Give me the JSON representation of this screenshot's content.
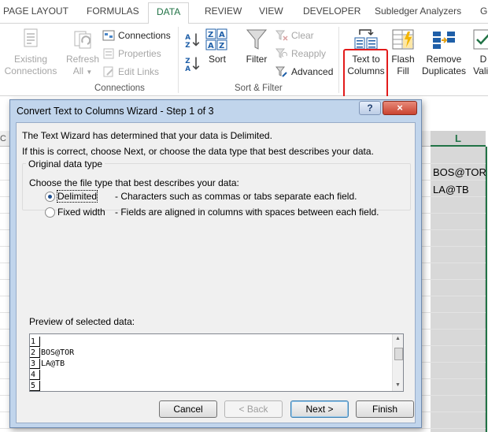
{
  "tabs": [
    {
      "label": "PAGE LAYOUT",
      "active": false
    },
    {
      "label": "FORMULAS",
      "active": false
    },
    {
      "label": "DATA",
      "active": true
    },
    {
      "label": "REVIEW",
      "active": false
    },
    {
      "label": "VIEW",
      "active": false
    },
    {
      "label": "DEVELOPER",
      "active": false
    },
    {
      "label": "Subledger Analyzers",
      "active": false
    },
    {
      "label": "G",
      "active": false
    }
  ],
  "ribbon": {
    "connections_group": {
      "existing_line1": "Existing",
      "existing_line2": "Connections",
      "refresh_line1": "Refresh",
      "refresh_line2": "All",
      "connections": "Connections",
      "properties": "Properties",
      "edit_links": "Edit Links",
      "label": "Connections"
    },
    "sort_filter_group": {
      "sort": "Sort",
      "filter": "Filter",
      "clear": "Clear",
      "reapply": "Reapply",
      "advanced": "Advanced",
      "label": "Sort & Filter"
    },
    "data_tools_group": {
      "text_to_columns_line1": "Text to",
      "text_to_columns_line2": "Columns",
      "flash_fill_line1": "Flash",
      "flash_fill_line2": "Fill",
      "remove_dup_line1": "Remove",
      "remove_dup_line2": "Duplicates",
      "data_valid_line1": "D",
      "data_valid_line2": "Valid"
    },
    "accent_color": "#217346",
    "highlight_color": "#e21b1b"
  },
  "sheet": {
    "left_col_header": "C",
    "selected_col_header": "L",
    "cells": [
      "BOS@TOR",
      "LA@TB"
    ]
  },
  "dialog": {
    "title": "Convert Text to Columns Wizard - Step 1 of 3",
    "help": "?",
    "close": "×",
    "intro_line1": "The Text Wizard has determined that your data is Delimited.",
    "intro_line2": "If this is correct, choose Next, or choose the data type that best describes your data.",
    "group_title": "Original data type",
    "choose_label": "Choose the file type that best describes your data:",
    "options": [
      {
        "label": "Delimited",
        "description": "- Characters such as commas or tabs separate each field.",
        "checked": true
      },
      {
        "label": "Fixed width",
        "description": "- Fields are aligned in columns with spaces between each field.",
        "checked": false
      }
    ],
    "preview_label": "Preview of selected data:",
    "preview_rows": [
      {
        "num": "1",
        "text": ""
      },
      {
        "num": "2",
        "text": "BOS@TOR"
      },
      {
        "num": "3",
        "text": "LA@TB"
      },
      {
        "num": "4",
        "text": ""
      },
      {
        "num": "5",
        "text": ""
      }
    ],
    "buttons": {
      "cancel": "Cancel",
      "back": "< Back",
      "next": "Next >",
      "finish": "Finish"
    }
  }
}
